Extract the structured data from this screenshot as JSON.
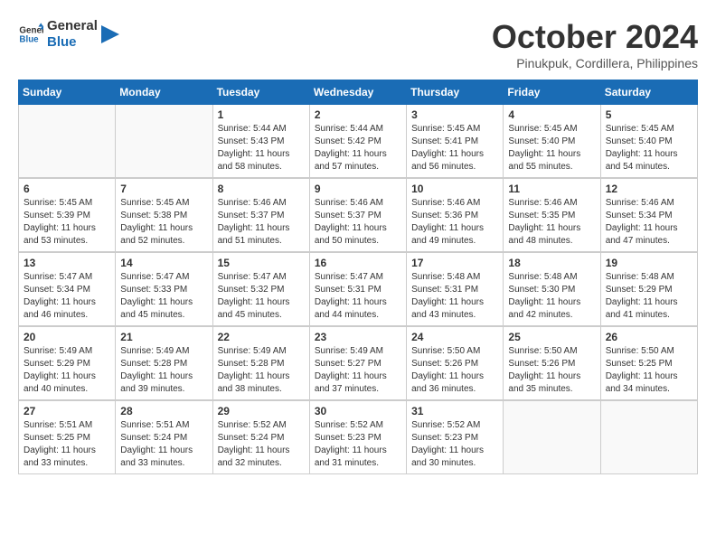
{
  "header": {
    "logo_line1": "General",
    "logo_line2": "Blue",
    "month": "October 2024",
    "location": "Pinukpuk, Cordillera, Philippines"
  },
  "weekdays": [
    "Sunday",
    "Monday",
    "Tuesday",
    "Wednesday",
    "Thursday",
    "Friday",
    "Saturday"
  ],
  "weeks": [
    [
      {
        "day": "",
        "info": ""
      },
      {
        "day": "",
        "info": ""
      },
      {
        "day": "1",
        "info": "Sunrise: 5:44 AM\nSunset: 5:43 PM\nDaylight: 11 hours and 58 minutes."
      },
      {
        "day": "2",
        "info": "Sunrise: 5:44 AM\nSunset: 5:42 PM\nDaylight: 11 hours and 57 minutes."
      },
      {
        "day": "3",
        "info": "Sunrise: 5:45 AM\nSunset: 5:41 PM\nDaylight: 11 hours and 56 minutes."
      },
      {
        "day": "4",
        "info": "Sunrise: 5:45 AM\nSunset: 5:40 PM\nDaylight: 11 hours and 55 minutes."
      },
      {
        "day": "5",
        "info": "Sunrise: 5:45 AM\nSunset: 5:40 PM\nDaylight: 11 hours and 54 minutes."
      }
    ],
    [
      {
        "day": "6",
        "info": "Sunrise: 5:45 AM\nSunset: 5:39 PM\nDaylight: 11 hours and 53 minutes."
      },
      {
        "day": "7",
        "info": "Sunrise: 5:45 AM\nSunset: 5:38 PM\nDaylight: 11 hours and 52 minutes."
      },
      {
        "day": "8",
        "info": "Sunrise: 5:46 AM\nSunset: 5:37 PM\nDaylight: 11 hours and 51 minutes."
      },
      {
        "day": "9",
        "info": "Sunrise: 5:46 AM\nSunset: 5:37 PM\nDaylight: 11 hours and 50 minutes."
      },
      {
        "day": "10",
        "info": "Sunrise: 5:46 AM\nSunset: 5:36 PM\nDaylight: 11 hours and 49 minutes."
      },
      {
        "day": "11",
        "info": "Sunrise: 5:46 AM\nSunset: 5:35 PM\nDaylight: 11 hours and 48 minutes."
      },
      {
        "day": "12",
        "info": "Sunrise: 5:46 AM\nSunset: 5:34 PM\nDaylight: 11 hours and 47 minutes."
      }
    ],
    [
      {
        "day": "13",
        "info": "Sunrise: 5:47 AM\nSunset: 5:34 PM\nDaylight: 11 hours and 46 minutes."
      },
      {
        "day": "14",
        "info": "Sunrise: 5:47 AM\nSunset: 5:33 PM\nDaylight: 11 hours and 45 minutes."
      },
      {
        "day": "15",
        "info": "Sunrise: 5:47 AM\nSunset: 5:32 PM\nDaylight: 11 hours and 45 minutes."
      },
      {
        "day": "16",
        "info": "Sunrise: 5:47 AM\nSunset: 5:31 PM\nDaylight: 11 hours and 44 minutes."
      },
      {
        "day": "17",
        "info": "Sunrise: 5:48 AM\nSunset: 5:31 PM\nDaylight: 11 hours and 43 minutes."
      },
      {
        "day": "18",
        "info": "Sunrise: 5:48 AM\nSunset: 5:30 PM\nDaylight: 11 hours and 42 minutes."
      },
      {
        "day": "19",
        "info": "Sunrise: 5:48 AM\nSunset: 5:29 PM\nDaylight: 11 hours and 41 minutes."
      }
    ],
    [
      {
        "day": "20",
        "info": "Sunrise: 5:49 AM\nSunset: 5:29 PM\nDaylight: 11 hours and 40 minutes."
      },
      {
        "day": "21",
        "info": "Sunrise: 5:49 AM\nSunset: 5:28 PM\nDaylight: 11 hours and 39 minutes."
      },
      {
        "day": "22",
        "info": "Sunrise: 5:49 AM\nSunset: 5:28 PM\nDaylight: 11 hours and 38 minutes."
      },
      {
        "day": "23",
        "info": "Sunrise: 5:49 AM\nSunset: 5:27 PM\nDaylight: 11 hours and 37 minutes."
      },
      {
        "day": "24",
        "info": "Sunrise: 5:50 AM\nSunset: 5:26 PM\nDaylight: 11 hours and 36 minutes."
      },
      {
        "day": "25",
        "info": "Sunrise: 5:50 AM\nSunset: 5:26 PM\nDaylight: 11 hours and 35 minutes."
      },
      {
        "day": "26",
        "info": "Sunrise: 5:50 AM\nSunset: 5:25 PM\nDaylight: 11 hours and 34 minutes."
      }
    ],
    [
      {
        "day": "27",
        "info": "Sunrise: 5:51 AM\nSunset: 5:25 PM\nDaylight: 11 hours and 33 minutes."
      },
      {
        "day": "28",
        "info": "Sunrise: 5:51 AM\nSunset: 5:24 PM\nDaylight: 11 hours and 33 minutes."
      },
      {
        "day": "29",
        "info": "Sunrise: 5:52 AM\nSunset: 5:24 PM\nDaylight: 11 hours and 32 minutes."
      },
      {
        "day": "30",
        "info": "Sunrise: 5:52 AM\nSunset: 5:23 PM\nDaylight: 11 hours and 31 minutes."
      },
      {
        "day": "31",
        "info": "Sunrise: 5:52 AM\nSunset: 5:23 PM\nDaylight: 11 hours and 30 minutes."
      },
      {
        "day": "",
        "info": ""
      },
      {
        "day": "",
        "info": ""
      }
    ]
  ]
}
